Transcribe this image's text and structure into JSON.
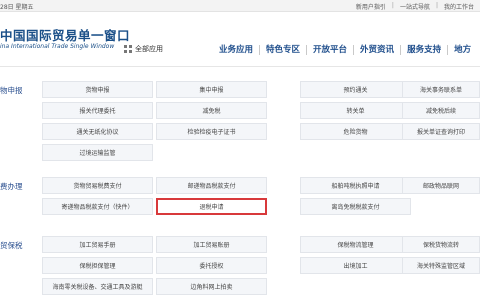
{
  "topbar": {
    "date": "28日 星期五",
    "links": [
      "新用户指引",
      "一站式导航",
      "我的工作台"
    ]
  },
  "header": {
    "title": "中国国际贸易单一窗口",
    "subtitle": "ina International Trade Single Window",
    "all_apps_label": "全部应用",
    "nav": [
      "业务应用",
      "特色专区",
      "开放平台",
      "外贸资讯",
      "服务支持",
      "地方"
    ]
  },
  "sections": [
    {
      "title": "物申报",
      "items": [
        [
          "货物申报",
          "集中申报",
          "预约通关",
          "海关事务联系单"
        ],
        [
          "报关代理委托",
          "减免税",
          "转关单",
          "减免税后续"
        ],
        [
          "通关无纸化协议",
          "检验检疫电子证书",
          "危险货物",
          "报关单证查询打印"
        ],
        [
          "过境运输监管"
        ]
      ]
    },
    {
      "title": "费办理",
      "items": [
        [
          "货物贸易税费支付",
          "邮递物品税款支付",
          "船舶吨税执照申请",
          "邮政物品联网"
        ],
        [
          "寄递物品税款支付（快件）",
          "退税申请",
          "离岛免税税款支付"
        ]
      ],
      "highlighted_item": "退税申请"
    },
    {
      "title": "贸保税",
      "items": [
        [
          "加工贸易手册",
          "加工贸易账册",
          "保税物流管理",
          "保税货物流转"
        ],
        [
          "保税担保管理",
          "委托授权",
          "出境加工",
          "海关特殊监管区域"
        ],
        [
          "海南零关税设备、交通工具及游艇",
          "边角料网上拍卖"
        ]
      ]
    }
  ]
}
